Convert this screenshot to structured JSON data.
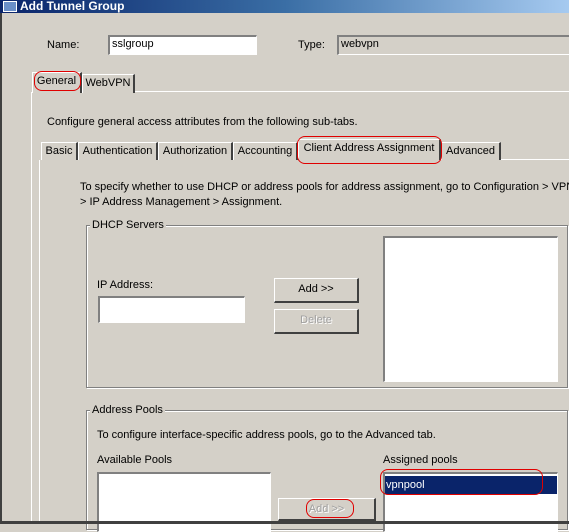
{
  "window": {
    "title": "Add Tunnel Group",
    "icon": "app-icon"
  },
  "fields": {
    "name_label": "Name:",
    "name_value": "sslgroup",
    "type_label": "Type:",
    "type_value": "webvpn"
  },
  "main_tabs": [
    {
      "label": "General",
      "selected": true
    },
    {
      "label": "WebVPN",
      "selected": false
    }
  ],
  "general": {
    "description": "Configure general access attributes from the following sub-tabs.",
    "sub_tabs": [
      {
        "label": "Basic"
      },
      {
        "label": "Authentication"
      },
      {
        "label": "Authorization"
      },
      {
        "label": "Accounting"
      },
      {
        "label": "Client Address Assignment",
        "selected": true
      },
      {
        "label": "Advanced"
      }
    ]
  },
  "client_address": {
    "info_line1": "To specify whether to use DHCP or address pools for address assignment, go to Configuration > VPN",
    "info_line2": "> IP Address Management > Assignment.",
    "dhcp": {
      "group_label": "DHCP Servers",
      "ip_label": "IP Address:",
      "ip_value": "",
      "add_button": "Add >>",
      "delete_button": "Delete",
      "servers": []
    },
    "pools": {
      "group_label": "Address Pools",
      "info": "To configure interface-specific address pools, go to the Advanced tab.",
      "available_label": "Available Pools",
      "available": [],
      "add_button": "Add >>",
      "assigned_label": "Assigned pools",
      "assigned": [
        "vpnpool"
      ]
    }
  },
  "colors": {
    "selection": "#0a246a",
    "annotation": "#e00000"
  }
}
